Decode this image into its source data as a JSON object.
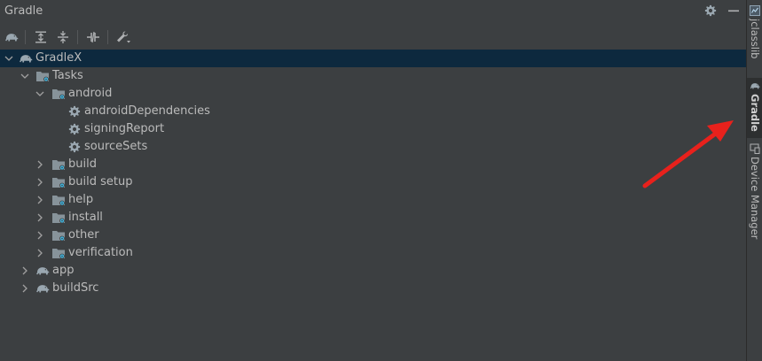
{
  "panel": {
    "title": "Gradle",
    "actions": [
      {
        "icon": "gear-icon"
      },
      {
        "icon": "minimize-icon"
      }
    ]
  },
  "toolbar": {
    "buttons": [
      {
        "icon": "gradle-elephant-icon"
      },
      {
        "icon": "expand-all-icon"
      },
      {
        "icon": "collapse-all-icon"
      },
      {
        "icon": "toggle-offline-icon"
      },
      {
        "icon": "wrench-icon"
      }
    ]
  },
  "tree": {
    "root": "GradleX",
    "tasks_label": "Tasks",
    "android_label": "android",
    "android_tasks": [
      "androidDependencies",
      "signingReport",
      "sourceSets"
    ],
    "groups": [
      "build",
      "build setup",
      "help",
      "install",
      "other",
      "verification"
    ],
    "modules": [
      "app",
      "buildSrc"
    ]
  },
  "side_tabs": {
    "jclasslib": "jclasslib",
    "gradle": "Gradle",
    "device_manager": "Device Manager"
  },
  "colors": {
    "background": "#3c3f41",
    "selection": "#0d293e",
    "folder": "#87939a",
    "gear": "#9aa7b0",
    "annotation_arrow": "#e8211c"
  }
}
